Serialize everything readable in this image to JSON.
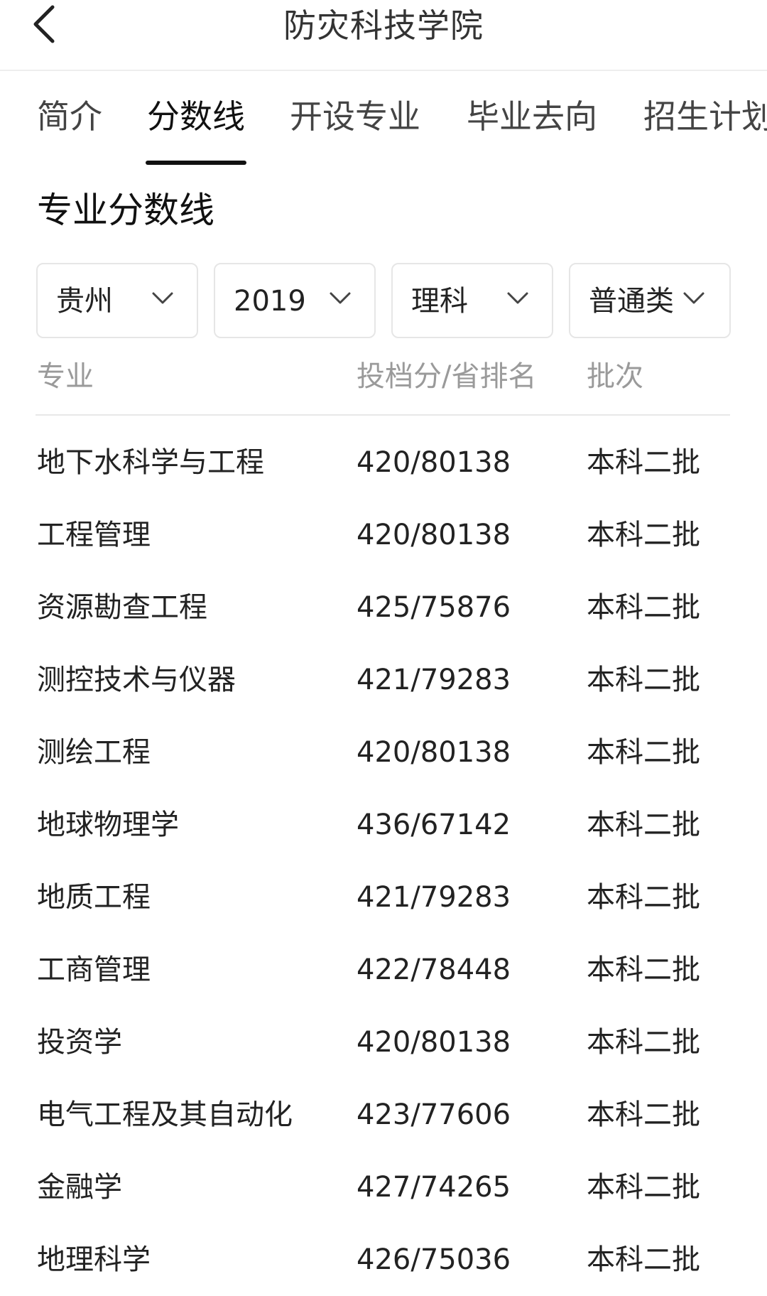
{
  "header": {
    "title": "防灾科技学院"
  },
  "tabs": [
    {
      "label": "简介"
    },
    {
      "label": "分数线"
    },
    {
      "label": "开设专业"
    },
    {
      "label": "毕业去向"
    },
    {
      "label": "招生计划"
    }
  ],
  "active_tab": "分数线",
  "section": {
    "title": "专业分数线"
  },
  "filters": [
    {
      "value": "贵州",
      "icon": "chevron-down-icon"
    },
    {
      "value": "2019",
      "icon": "chevron-down-icon"
    },
    {
      "value": "理科",
      "icon": "chevron-down-icon"
    },
    {
      "value": "普通类",
      "icon": "chevron-down-icon"
    }
  ],
  "table": {
    "columns": [
      "专业",
      "投档分/省排名",
      "批次"
    ],
    "rows": [
      {
        "major": "地下水科学与工程",
        "score": "420/80138",
        "batch": "本科二批"
      },
      {
        "major": "工程管理",
        "score": "420/80138",
        "batch": "本科二批"
      },
      {
        "major": "资源勘查工程",
        "score": "425/75876",
        "batch": "本科二批"
      },
      {
        "major": "测控技术与仪器",
        "score": "421/79283",
        "batch": "本科二批"
      },
      {
        "major": "测绘工程",
        "score": "420/80138",
        "batch": "本科二批"
      },
      {
        "major": "地球物理学",
        "score": "436/67142",
        "batch": "本科二批"
      },
      {
        "major": "地质工程",
        "score": "421/79283",
        "batch": "本科二批"
      },
      {
        "major": "工商管理",
        "score": "422/78448",
        "batch": "本科二批"
      },
      {
        "major": "投资学",
        "score": "420/80138",
        "batch": "本科二批"
      },
      {
        "major": "电气工程及其自动化",
        "score": "423/77606",
        "batch": "本科二批"
      },
      {
        "major": "金融学",
        "score": "427/74265",
        "batch": "本科二批"
      },
      {
        "major": "地理科学",
        "score": "426/75036",
        "batch": "本科二批"
      }
    ]
  }
}
